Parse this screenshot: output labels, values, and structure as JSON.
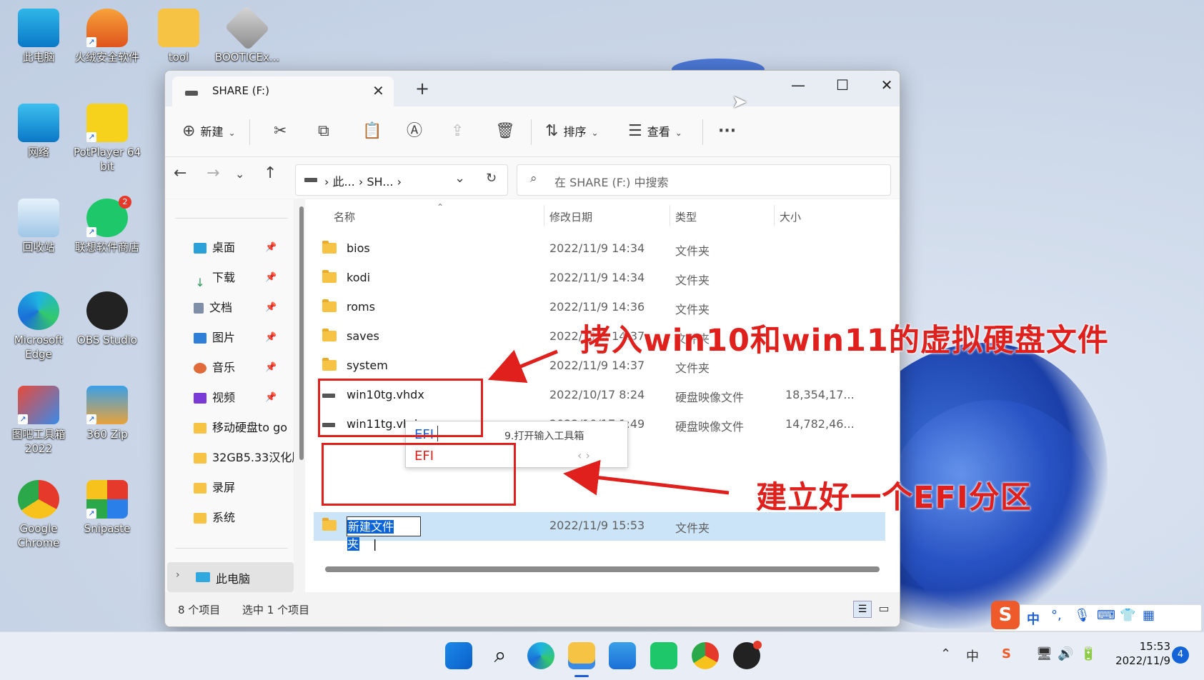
{
  "desktop": {
    "icons": [
      {
        "label": "此电脑"
      },
      {
        "label": "火绒安全软件"
      },
      {
        "label": "tool"
      },
      {
        "label": "BOOTICEx..."
      },
      {
        "label": "网络"
      },
      {
        "label": "PotPlayer 64 bit"
      },
      {
        "label": "回收站"
      },
      {
        "label": "联想软件商店"
      },
      {
        "label": "Microsoft Edge"
      },
      {
        "label": "OBS Studio"
      },
      {
        "label": "图吧工具箱 2022"
      },
      {
        "label": "360 Zip"
      },
      {
        "label": "Google Chrome"
      },
      {
        "label": "Snipaste"
      }
    ],
    "store_badge": "2"
  },
  "window": {
    "tab_title": "SHARE (F:)",
    "toolbar": {
      "new_label": "新建",
      "sort_label": "排序",
      "view_label": "查看",
      "more_label": "···"
    },
    "address": {
      "part1": "此...",
      "part2": "SH..."
    },
    "search_placeholder": "在 SHARE (F:) 中搜索",
    "sidebar": [
      {
        "label": "桌面",
        "color": "#2ca0d8"
      },
      {
        "label": "下载",
        "color": "#2c9a5a"
      },
      {
        "label": "文档",
        "color": "#7f8fa8"
      },
      {
        "label": "图片",
        "color": "#2f7fd8"
      },
      {
        "label": "音乐",
        "color": "#e06a3a"
      },
      {
        "label": "视频",
        "color": "#7a3ad8"
      },
      {
        "label": "移动硬盘to go",
        "color": "#f6c344"
      },
      {
        "label": "32GB5.33汉化版",
        "color": "#f6c344"
      },
      {
        "label": "录屏",
        "color": "#f6c344"
      },
      {
        "label": "系统",
        "color": "#f6c344"
      }
    ],
    "this_pc": "此电脑",
    "columns": {
      "name": "名称",
      "date": "修改日期",
      "type": "类型",
      "size": "大小"
    },
    "files": [
      {
        "name": "bios",
        "date": "2022/11/9 14:34",
        "type": "文件夹",
        "size": "",
        "kind": "folder"
      },
      {
        "name": "kodi",
        "date": "2022/11/9 14:34",
        "type": "文件夹",
        "size": "",
        "kind": "folder"
      },
      {
        "name": "roms",
        "date": "2022/11/9 14:36",
        "type": "文件夹",
        "size": "",
        "kind": "folder"
      },
      {
        "name": "saves",
        "date": "2022/11/9 14:37",
        "type": "文件夹",
        "size": "",
        "kind": "folder"
      },
      {
        "name": "system",
        "date": "2022/11/9 14:37",
        "type": "文件夹",
        "size": "",
        "kind": "folder"
      },
      {
        "name": "win10tg.vhdx",
        "date": "2022/10/17 8:24",
        "type": "硬盘映像文件",
        "size": "18,354,17...",
        "kind": "vhdx"
      },
      {
        "name": "win11tg.vhdx",
        "date": "2022/10/17 1:49",
        "type": "硬盘映像文件",
        "size": "14,782,46...",
        "kind": "vhdx"
      }
    ],
    "renaming": {
      "value": "新建文件夹",
      "date": "2022/11/9 15:53",
      "type": "文件夹"
    },
    "ime_popup": {
      "composition": "EFI",
      "hint": "9.打开输入工具箱",
      "candidate": "EFI"
    },
    "status": {
      "count": "8 个项目",
      "selected": "选中 1 个项目"
    }
  },
  "annotations": {
    "copy_note": "拷入win10和win11的虚拟硬盘文件",
    "efi_note": "建立好一个EFI分区"
  },
  "ime_bar": {
    "mode": "中"
  },
  "taskbar": {
    "tray_ime": "中",
    "time": "15:53",
    "date": "2022/11/9",
    "notifications": "4"
  }
}
